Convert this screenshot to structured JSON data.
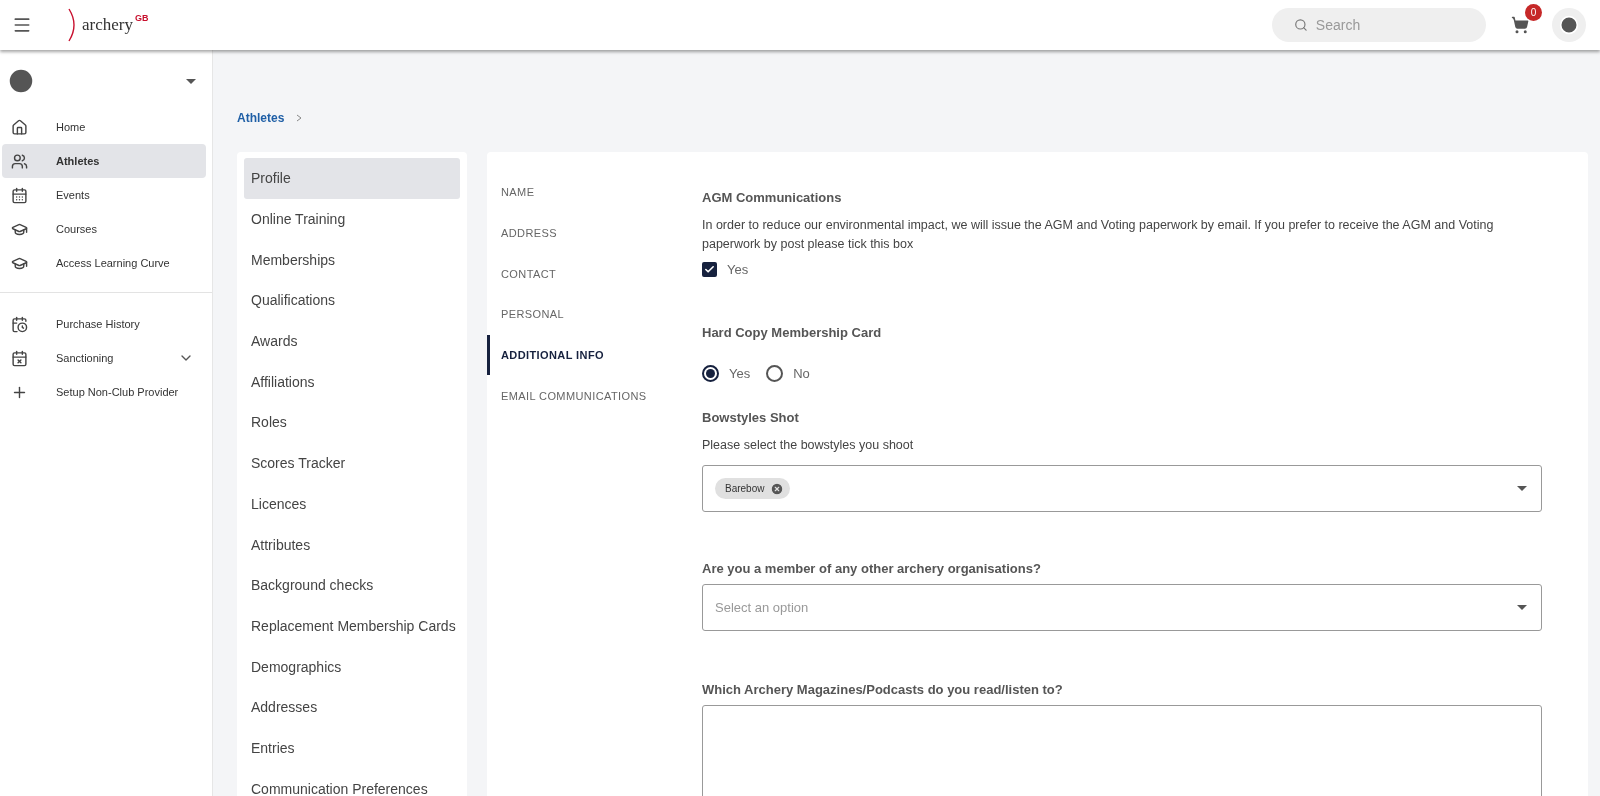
{
  "topbar": {
    "logo": {
      "text": "archery",
      "mark": "GB"
    },
    "search": {
      "placeholder": "Search"
    },
    "cart": {
      "count": "0"
    }
  },
  "sidebar": {
    "groups": [
      {
        "items": [
          {
            "kind": "home",
            "label": "Home",
            "selected": false,
            "has_submenu": false
          },
          {
            "kind": "people",
            "label": "Athletes",
            "selected": true,
            "has_submenu": false
          },
          {
            "kind": "calendar",
            "label": "Events",
            "selected": false,
            "has_submenu": false
          },
          {
            "kind": "school",
            "label": "Courses",
            "selected": false,
            "has_submenu": false
          },
          {
            "kind": "school-outline",
            "label": "Access Learning Curve",
            "selected": false,
            "has_submenu": false
          }
        ]
      },
      {
        "items": [
          {
            "kind": "history",
            "label": "Purchase History",
            "selected": false,
            "has_submenu": false
          },
          {
            "kind": "question-calendar",
            "label": "Sanctioning",
            "selected": false,
            "has_submenu": true
          },
          {
            "kind": "plus",
            "label": "Setup Non-Club Provider",
            "selected": false,
            "has_submenu": false
          }
        ]
      }
    ]
  },
  "breadcrumb": [
    "Athletes"
  ],
  "profile_menu": [
    {
      "label": "Profile",
      "selected": true
    },
    {
      "label": "Online Training",
      "selected": false
    },
    {
      "label": "Memberships",
      "selected": false
    },
    {
      "label": "Qualifications",
      "selected": false
    },
    {
      "label": "Awards",
      "selected": false
    },
    {
      "label": "Affiliations",
      "selected": false
    },
    {
      "label": "Roles",
      "selected": false
    },
    {
      "label": "Scores Tracker",
      "selected": false
    },
    {
      "label": "Licences",
      "selected": false
    },
    {
      "label": "Attributes",
      "selected": false
    },
    {
      "label": "Background checks",
      "selected": false
    },
    {
      "label": "Replacement Membership Cards",
      "selected": false
    },
    {
      "label": "Demographics",
      "selected": false
    },
    {
      "label": "Addresses",
      "selected": false
    },
    {
      "label": "Entries",
      "selected": false
    },
    {
      "label": "Communication Preferences",
      "selected": false
    }
  ],
  "section_nav": [
    {
      "label": "NAME",
      "selected": false
    },
    {
      "label": "ADDRESS",
      "selected": false
    },
    {
      "label": "CONTACT",
      "selected": false
    },
    {
      "label": "PERSONAL",
      "selected": false
    },
    {
      "label": "ADDITIONAL INFO",
      "selected": true
    },
    {
      "label": "EMAIL COMMUNICATIONS",
      "selected": false
    }
  ],
  "fields": [
    {
      "kind": "checkbox",
      "title": "AGM Communications",
      "description": "In order to reduce our environmental impact, we will issue the AGM and Voting paperwork by email. If you prefer to receive the AGM and Voting paperwork by post please tick this box",
      "option": {
        "label": "Yes",
        "checked": true
      }
    },
    {
      "kind": "radio",
      "title": "Hard Copy Membership Card",
      "options": [
        {
          "label": "Yes",
          "selected": true
        },
        {
          "label": "No",
          "selected": false
        }
      ]
    },
    {
      "kind": "multiselect",
      "title": "Bowstyles Shot",
      "description": "Please select the bowstyles you shoot",
      "chips": [
        "Barebow"
      ]
    },
    {
      "kind": "select",
      "title": "Are you a member of any other archery organisations?",
      "placeholder": "Select an option"
    },
    {
      "kind": "textarea",
      "title": "Which Archery Magazines/Podcasts do you read/listen to?"
    }
  ]
}
